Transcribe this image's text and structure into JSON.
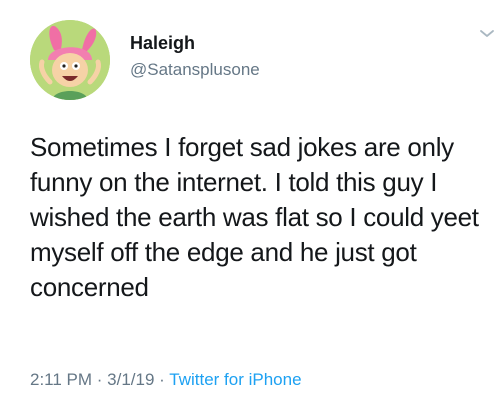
{
  "tweet": {
    "display_name": "Haleigh",
    "handle": "@Satansplusone",
    "text": "Sometimes I forget sad jokes are only funny on the internet. I told this guy I wished the earth was flat so I could yeet myself off the edge and he just got concerned",
    "time": "2:11 PM",
    "separator": " · ",
    "date": "3/1/19",
    "source": "Twitter for iPhone"
  },
  "icons": {
    "avatar": "cartoon-avatar",
    "menu": "chevron-down-icon"
  },
  "colors": {
    "name_text": "#14171a",
    "secondary_text": "#657786",
    "link": "#1da1f2",
    "background": "#ffffff"
  }
}
